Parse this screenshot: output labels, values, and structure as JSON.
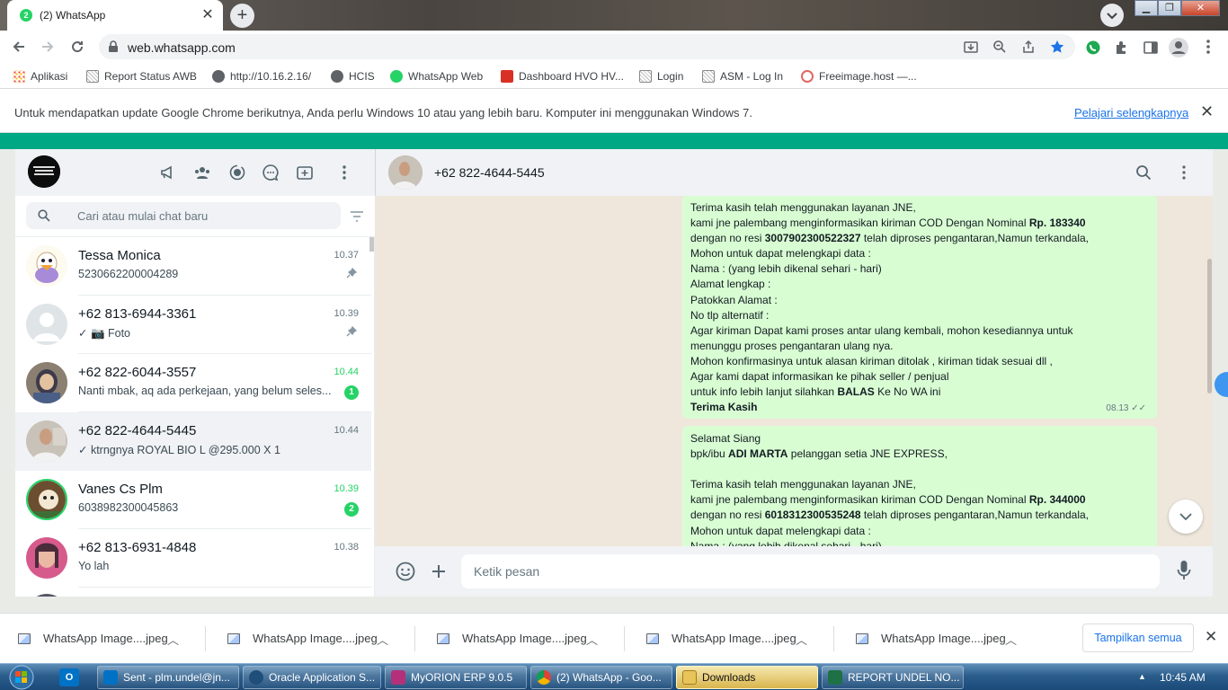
{
  "browser": {
    "tab_title": "(2) WhatsApp",
    "tab_favicon_badge": "2",
    "url": "web.whatsapp.com",
    "bookmarks": [
      {
        "label": "Aplikasi",
        "icon": "apps-grid-icon"
      },
      {
        "label": "Report Status AWB",
        "icon": "page-icon"
      },
      {
        "label": "http://10.16.2.16/",
        "icon": "globe-icon"
      },
      {
        "label": "HCIS",
        "icon": "globe-icon"
      },
      {
        "label": "WhatsApp Web",
        "icon": "whatsapp-icon"
      },
      {
        "label": "Dashboard HVO HV...",
        "icon": "dashboard-icon"
      },
      {
        "label": "Login",
        "icon": "page-icon"
      },
      {
        "label": "ASM - Log In",
        "icon": "page-icon"
      },
      {
        "label": "Freeimage.host —...",
        "icon": "freeimage-icon"
      }
    ],
    "infobar": {
      "text": "Untuk mendapatkan update Google Chrome berikutnya, Anda perlu Windows 10 atau yang lebih baru. Komputer ini menggunakan Windows 7.",
      "link": "Pelajari selengkapnya"
    }
  },
  "whatsapp": {
    "search_placeholder": "Cari atau mulai chat baru",
    "chats": [
      {
        "name": "Tessa Monica",
        "time": "10.37",
        "preview": "5230662200004289",
        "pinned": true,
        "unread": ""
      },
      {
        "name": "+62 813-6944-3361",
        "time": "10.39",
        "preview": "✓ 📷 Foto",
        "pinned": true,
        "unread": ""
      },
      {
        "name": "+62 822-6044-3557",
        "time": "10.44",
        "preview": "Nanti mbak, aq ada perkejaan, yang belum seles...",
        "pinned": false,
        "unread": "1"
      },
      {
        "name": "+62 822-4644-5445",
        "time": "10.44",
        "preview": "✓ ktrngnya ROYAL BIO L @295.000 X 1",
        "pinned": false,
        "unread": ""
      },
      {
        "name": "Vanes Cs Plm",
        "time": "10.39",
        "preview": "6038982300045863",
        "pinned": false,
        "unread": "2"
      },
      {
        "name": "+62 813-6931-4848",
        "time": "10.38",
        "preview": "Yo lah",
        "pinned": false,
        "unread": ""
      }
    ],
    "conversation": {
      "contact": "+62 822-4644-5445",
      "message1": {
        "l1": "Terima kasih telah menggunakan layanan JNE,",
        "l2a": "kami jne palembang menginformasikan kiriman  COD Dengan Nominal ",
        "l2b": "Rp. 183340",
        "l3a": "dengan no resi ",
        "l3b": "3007902300522327",
        "l3c": " telah diproses pengantaran,Namun terkandala,",
        "l4": "Mohon untuk dapat melengkapi data :",
        "l5": "Nama : (yang lebih dikenal sehari - hari)",
        "l6": "Alamat  lengkap :",
        "l7": "Patokkan Alamat :",
        "l8": "No tlp alternatif :",
        "l9": "Agar kiriman Dapat kami proses antar ulang kembali, mohon kesediannya untuk",
        "l10": "menunggu proses pengantaran ulang nya.",
        "l11": "Mohon konfirmasinya untuk alasan kiriman ditolak , kiriman tidak sesuai dll ,",
        "l12": " Agar kami dapat informasikan ke pihak seller / penjual",
        "l13a": "untuk info lebih lanjut silahkan ",
        "l13b": "BALAS",
        "l13c": " Ke No WA ini",
        "l14": "Terima Kasih",
        "time": "08.13"
      },
      "message2": {
        "l1": "Selamat Siang",
        "l2a": " bpk/ibu ",
        "l2b": "ADI MARTA",
        "l2c": " pelanggan setia JNE EXPRESS,",
        "l3": "Terima kasih telah menggunakan layanan JNE,",
        "l4a": "kami jne palembang menginformasikan kiriman  COD Dengan Nominal ",
        "l4b": "Rp. 344000",
        "l5a": "dengan no resi ",
        "l5b": "6018312300535248",
        "l5c": " telah diproses pengantaran,Namun terkandala,",
        "l6": "Mohon untuk dapat melengkapi data :",
        "l7": "Nama : (yang lebih dikenal sehari - hari)"
      },
      "input_placeholder": "Ketik pesan"
    }
  },
  "downloads": {
    "items": [
      "WhatsApp Image....jpeg",
      "WhatsApp Image....jpeg",
      "WhatsApp Image....jpeg",
      "WhatsApp Image....jpeg",
      "WhatsApp Image....jpeg"
    ],
    "show_all": "Tampilkan semua"
  },
  "taskbar": {
    "items": [
      {
        "label": "Sent - plm.undel@jn...",
        "icon": "outlook-icon"
      },
      {
        "label": "Oracle Application S...",
        "icon": "oracle-icon"
      },
      {
        "label": "MyORION ERP 9.0.5",
        "icon": "erp-icon"
      },
      {
        "label": "(2) WhatsApp - Goo...",
        "icon": "chrome-icon"
      },
      {
        "label": "Downloads",
        "icon": "folder-icon"
      },
      {
        "label": "REPORT UNDEL NO...",
        "icon": "excel-icon"
      }
    ],
    "clock": "10:45 AM"
  },
  "colors": {
    "accent": "#00a884",
    "bubble": "#d9fdd3",
    "unread": "#25d366",
    "link": "#1a73e8"
  }
}
